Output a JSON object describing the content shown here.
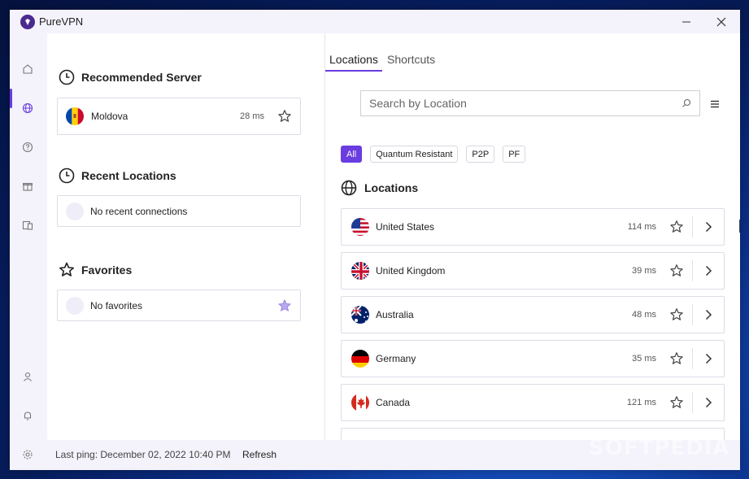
{
  "window": {
    "title": "PureVPN"
  },
  "left": {
    "recommended": {
      "heading": "Recommended Server",
      "country": "Moldova",
      "ping": "28 ms"
    },
    "recent": {
      "heading": "Recent Locations",
      "empty_text": "No recent connections"
    },
    "favorites": {
      "heading": "Favorites",
      "empty_text": "No favorites"
    }
  },
  "tabs": [
    {
      "label": "Locations",
      "active": true
    },
    {
      "label": "Shortcuts",
      "active": false
    }
  ],
  "search": {
    "placeholder": "Search by Location"
  },
  "filters": [
    {
      "label": "All",
      "active": true
    },
    {
      "label": "Quantum Resistant",
      "active": false
    },
    {
      "label": "P2P",
      "active": false
    },
    {
      "label": "PF",
      "active": false
    }
  ],
  "locations": {
    "heading": "Locations",
    "items": [
      {
        "name": "United States",
        "ping": "114 ms",
        "flag": "us"
      },
      {
        "name": "United Kingdom",
        "ping": "39 ms",
        "flag": "uk"
      },
      {
        "name": "Australia",
        "ping": "48 ms",
        "flag": "au"
      },
      {
        "name": "Germany",
        "ping": "35 ms",
        "flag": "de"
      },
      {
        "name": "Canada",
        "ping": "121 ms",
        "flag": "ca"
      }
    ]
  },
  "footer": {
    "last_ping": "Last ping: December 02, 2022 10:40 PM",
    "refresh_label": "Refresh"
  },
  "watermark": "SOFTPEDIA",
  "colors": {
    "accent": "#6a3de0",
    "sidebar_bg": "#f4f2fa",
    "brand": "#4b2a8f"
  }
}
